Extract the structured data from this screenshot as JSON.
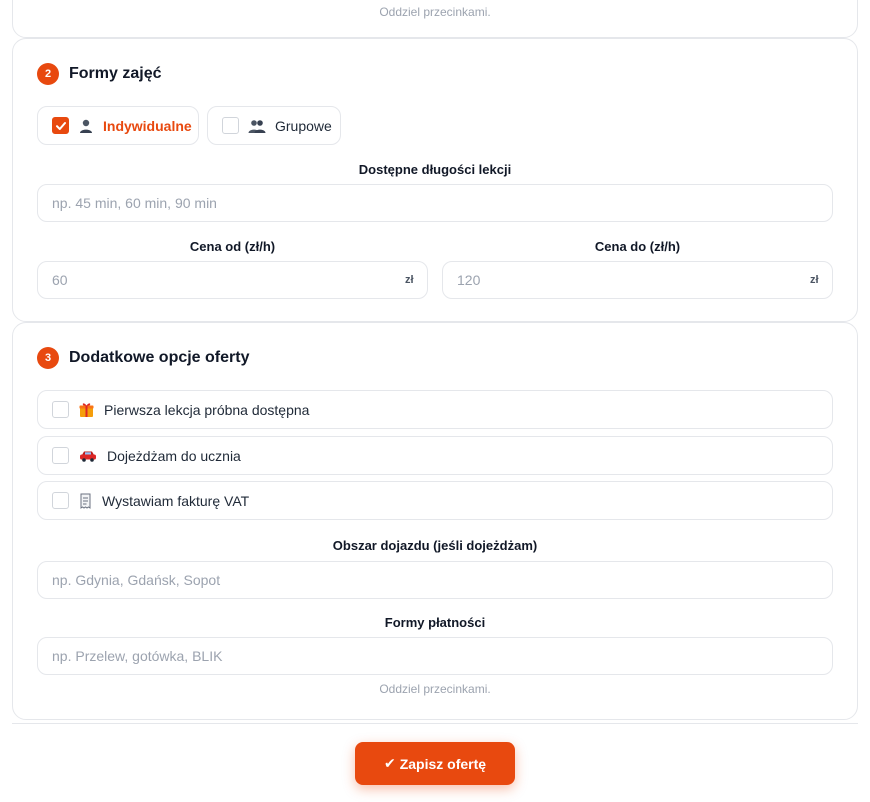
{
  "top_section": {
    "hint": "Oddziel przecinkami."
  },
  "section2": {
    "number": "2",
    "title": "Formy zajęć",
    "forms": [
      {
        "label": "Indywidualne",
        "icon": "person-icon",
        "checked": true
      },
      {
        "label": "Grupowe",
        "icon": "group-icon",
        "checked": false
      }
    ],
    "lengths": {
      "label": "Dostępne długości lekcji",
      "placeholder": "np. 45 min, 60 min, 90 min"
    },
    "price_from": {
      "label": "Cena od (zł/h)",
      "placeholder": "60",
      "suffix": "zł"
    },
    "price_to": {
      "label": "Cena do (zł/h)",
      "placeholder": "120",
      "suffix": "zł"
    }
  },
  "section3": {
    "number": "3",
    "title": "Dodatkowe opcje oferty",
    "options": [
      {
        "label": "Pierwsza lekcja próbna dostępna",
        "icon": "gift-icon",
        "checked": false
      },
      {
        "label": "Dojeżdżam do ucznia",
        "icon": "car-icon",
        "checked": false
      },
      {
        "label": "Wystawiam fakturę VAT",
        "icon": "receipt-icon",
        "checked": false
      }
    ],
    "area": {
      "label": "Obszar dojazdu (jeśli dojeżdżam)",
      "placeholder": "np. Gdynia, Gdańsk, Sopot"
    },
    "payments": {
      "label": "Formy płatności",
      "placeholder": "np. Przelew, gotówka, BLIK",
      "hint": "Oddziel przecinkami."
    }
  },
  "save_button": {
    "icon": "✔",
    "label": "Zapisz ofertę"
  },
  "colors": {
    "accent": "#e8490f",
    "border": "#e5e7eb",
    "muted": "#9ca3af"
  }
}
